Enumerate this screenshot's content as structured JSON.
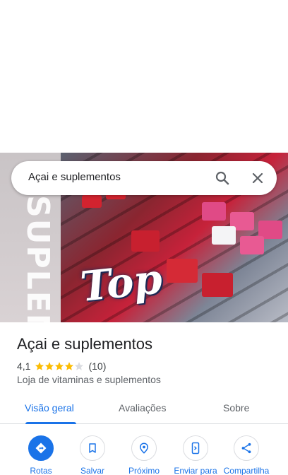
{
  "search": {
    "query": "Açai e suplementos"
  },
  "hero": {
    "banner_text": "SUPLEME",
    "logo_text": "Top"
  },
  "place": {
    "title": "Açai e suplementos",
    "rating": "4,1",
    "rating_value": 4.1,
    "reviews": "(10)",
    "category": "Loja de vitaminas e suplementos"
  },
  "tabs": [
    {
      "label": "Visão geral",
      "active": true
    },
    {
      "label": "Avaliações",
      "active": false
    },
    {
      "label": "Sobre",
      "active": false
    }
  ],
  "actions": [
    {
      "label": "Rotas",
      "icon": "directions-icon"
    },
    {
      "label": "Salvar",
      "icon": "bookmark-icon"
    },
    {
      "label": "Próximo",
      "icon": "nearby-icon"
    },
    {
      "label": "Enviar para",
      "icon": "send-to-phone-icon"
    },
    {
      "label": "Compartilha",
      "icon": "share-icon"
    }
  ],
  "colors": {
    "accent": "#1a73e8",
    "star": "#fbbc04",
    "star_empty": "#dadce0",
    "text": "#202124",
    "muted": "#5f6368"
  }
}
